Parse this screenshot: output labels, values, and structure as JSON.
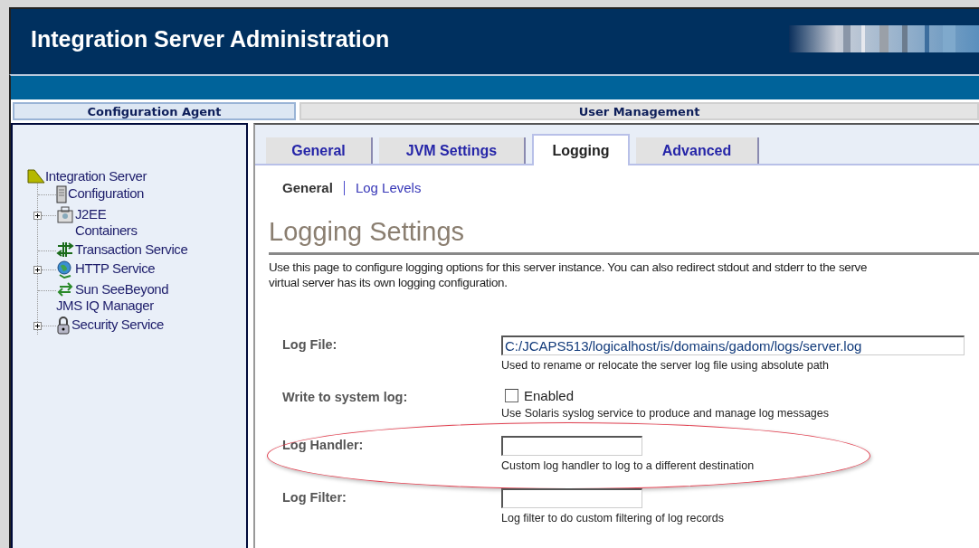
{
  "header": {
    "title": "Integration Server Administration"
  },
  "top_tabs": [
    {
      "label": "Configuration Agent",
      "selected": true
    },
    {
      "label": "User Management",
      "selected": false
    }
  ],
  "tree": {
    "label": "Integration Server",
    "children": [
      {
        "kind": "server",
        "lines": [
          "Configuration"
        ],
        "expandable": false
      },
      {
        "kind": "container",
        "lines": [
          "J2EE",
          "Containers"
        ],
        "expandable": true
      },
      {
        "kind": "transaction",
        "lines": [
          "Transaction Service"
        ],
        "expandable": false
      },
      {
        "kind": "globe",
        "lines": [
          "HTTP Service"
        ],
        "expandable": true
      },
      {
        "kind": "exchange",
        "lines": [
          "Sun SeeBeyond",
          "JMS IQ Manager"
        ],
        "expandable": false
      },
      {
        "kind": "lock",
        "lines": [
          "Security Service"
        ],
        "expandable": true
      }
    ]
  },
  "tabs": [
    {
      "label": "General",
      "selected": false
    },
    {
      "label": "JVM Settings",
      "selected": false
    },
    {
      "label": "Logging",
      "selected": true
    },
    {
      "label": "Advanced",
      "selected": false
    }
  ],
  "sub_links": [
    {
      "label": "General",
      "selected": true
    },
    {
      "label": "Log Levels",
      "selected": false
    }
  ],
  "heading": "Logging Settings",
  "description": [
    "Use this page to configure logging options for this server instance. You can also redirect stdout and stderr to the serve",
    "virtual server has its own logging configuration."
  ],
  "fields": [
    {
      "kind": "text",
      "label": "Log File:",
      "value": "C:/JCAPS513/logicalhost/is/domains/gadom/logs/server.log",
      "hint": "Used to rename or relocate the server log file using absolute path",
      "highlighted": false
    },
    {
      "kind": "checkbox",
      "label": "Write to system log:",
      "option": "Enabled",
      "checked": false,
      "hint": "Use Solaris syslog service to produce and manage log messages",
      "highlighted": false
    },
    {
      "kind": "text",
      "label": "Log Handler:",
      "hint": "Custom log handler to log to a different destination",
      "highlighted": true
    },
    {
      "kind": "text",
      "label": "Log Filter:",
      "hint": "Log filter to do custom filtering of log records",
      "highlighted": false
    }
  ]
}
